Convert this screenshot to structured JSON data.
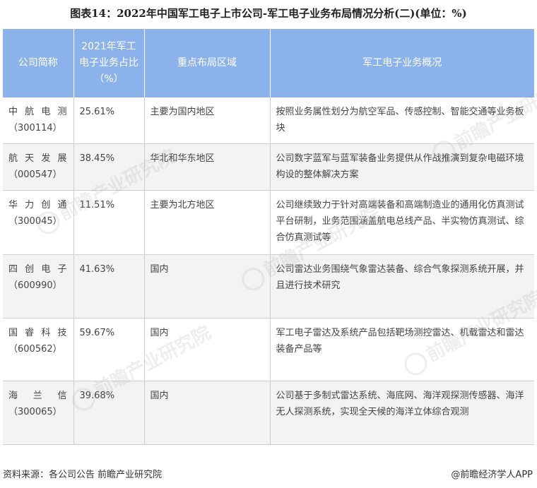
{
  "title": "图表14：2022年中国军工电子上市公司-军工电子业务布局情况分析(二)(单位：%)",
  "headers": [
    "公司简称",
    "2021年军工电子业务占比（%）",
    "重点布局区域",
    "军工电子业务概况"
  ],
  "rows": [
    {
      "name": "中航电测",
      "code": "（300114）",
      "share": "25.61%",
      "region": "主要为国内地区",
      "overview": "按照业务属性划分为航空军品、传感控制、智能交通等业务板块"
    },
    {
      "name": "航天发展",
      "code": "（000547）",
      "share": "38.45%",
      "region": "华北和华东地区",
      "overview": "公司数字蓝军与蓝军装备业务提供从作战推演到复杂电磁环境构设的整体解决方案"
    },
    {
      "name": "华力创通",
      "code": "（300045）",
      "share": "11.51%",
      "region": "主要为北方地区",
      "overview": "公司继续致力于针对高端装备和高端制造业的通用化仿真测试平台研制，业务范围涵盖航电总线产品、半实物仿真测试、综合仿真测试等"
    },
    {
      "name": "四创电子",
      "code": "（600990）",
      "share": "41.63%",
      "region": "国内",
      "overview": "公司雷达业务围绕气象雷达装备、综合气象探测系统开展，并且进行技术研究"
    },
    {
      "name": "国睿科技",
      "code": "（600562）",
      "share": "59.67%",
      "region": "国内",
      "overview": "军工电子雷达及系统产品包括靶场测控雷达、机载雷达和雷达装备产品等"
    },
    {
      "name": "海兰信",
      "code": "（300065）",
      "share": "39.68%",
      "region": "国内",
      "overview": "公司基于多制式雷达系统、海底网、海洋观探测传感器、海洋无人探测系统，实现全天候的海洋立体综合观测"
    }
  ],
  "footer": {
    "source": "资料来源：各公司公告 前瞻产业研究院",
    "brand": "@前瞻经济学人APP"
  },
  "watermark": "前瞻产业研究院"
}
